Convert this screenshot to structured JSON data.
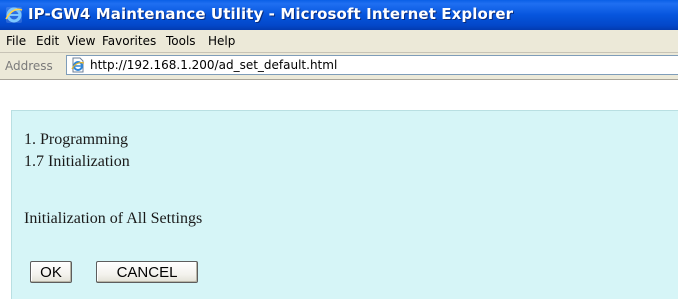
{
  "window": {
    "title": "IP-GW4 Maintenance Utility - Microsoft Internet Explorer",
    "icon": "ie-icon"
  },
  "menubar": {
    "items": [
      {
        "label": "File"
      },
      {
        "label": "Edit"
      },
      {
        "label": "View"
      },
      {
        "label": "Favorites"
      },
      {
        "label": "Tools"
      },
      {
        "label": "Help"
      }
    ]
  },
  "addressbar": {
    "label": "Address",
    "url": "http://192.168.1.200/ad_set_default.html",
    "icon": "page-icon"
  },
  "page": {
    "section_title": "1. Programming",
    "subsection_title": "1.7 Initialization",
    "description": "Initialization of All Settings",
    "ok_label": "OK",
    "cancel_label": "CANCEL"
  },
  "colors": {
    "titlebar": "#0655dd",
    "panel_background": "#d6f5f7",
    "chrome": "#ece9d8"
  }
}
